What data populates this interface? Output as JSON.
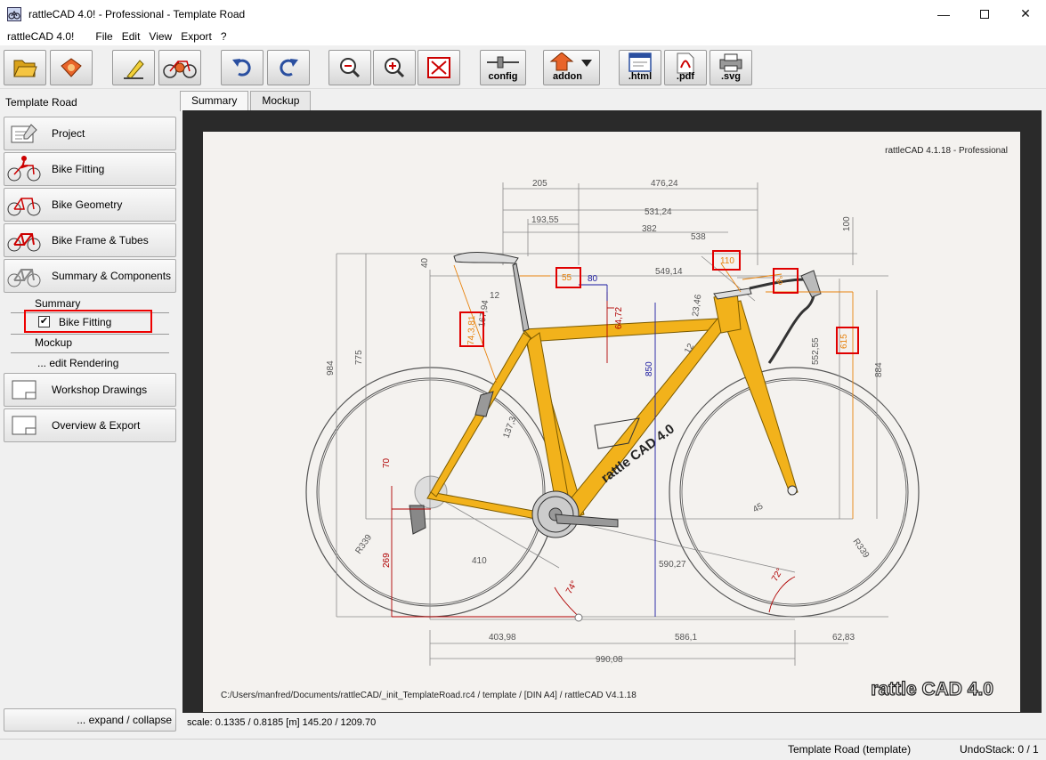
{
  "window": {
    "title": "rattleCAD 4.0! - Professional  - Template Road"
  },
  "menu": {
    "app_name": "rattleCAD 4.0!",
    "items": [
      "File",
      "Edit",
      "View",
      "Export",
      "?"
    ]
  },
  "toolbar": {
    "config_label": "config",
    "addon_label": "addon",
    "html_label": ".html",
    "pdf_label": ".pdf",
    "svg_label": ".svg"
  },
  "left_panel": {
    "title": "Template Road",
    "items": [
      "Project",
      "Bike Fitting",
      "Bike Geometry",
      "Bike Frame & Tubes",
      "Summary & Components"
    ],
    "summary_label": "Summary",
    "bike_fitting_check": "Bike Fitting",
    "bike_fitting_checked": true,
    "mockup_label": "Mockup",
    "edit_rendering_label": "... edit Rendering",
    "items2": [
      "Workshop Drawings",
      "Overview & Export"
    ],
    "expand_label": "... expand / collapse"
  },
  "tabs": [
    "Summary",
    "Mockup"
  ],
  "drawing": {
    "version_label": "rattleCAD  4.1.18  -  Professional",
    "footer_path": "C:/Users/manfred/Documents/rattleCAD/_init_TemplateRoad.rc4   /   template   /  [DIN A4]  /   rattleCAD   V4.1.18",
    "logo_text": "rattle CAD 4.0",
    "frame_text": "rattle CAD 4.0",
    "dims": {
      "d205": "205",
      "d476": "476,24",
      "d193": "193,55",
      "d531": "531,24",
      "d382": "382",
      "d538": "538",
      "d100": "100",
      "d40": "40",
      "d55": "55",
      "d80": "80",
      "d549": "549,14",
      "d110": "110",
      "d8": "8°",
      "d12a": "12",
      "d16794": "167,94",
      "d74381": "74,3,81",
      "d6472": "64,72",
      "d2346": "23,46",
      "d12b": "12",
      "d850": "850",
      "d615": "615",
      "d775": "775",
      "d984": "984",
      "d55255": "552,55",
      "d884": "884",
      "d1373": "137,3",
      "d70": "70",
      "d269": "269",
      "d410": "410",
      "d59027": "590,27",
      "d45": "45",
      "dR339a": "R339",
      "dR339b": "R339",
      "d74deg": "74°",
      "d72deg": "72°",
      "d40398": "403,98",
      "d5861": "586,1",
      "d6283": "62,83",
      "d99008": "990,08"
    }
  },
  "scale_text": "scale: 0.1335 / 0.8185  [m]  145.20 / 1209.70",
  "status": {
    "doc": "Template Road (template)",
    "undo": "UndoStack:  0 /  1"
  },
  "colors": {
    "frame": "#f2b21b",
    "frame_edge": "#7a5a00",
    "dim_grey": "#707070",
    "dim_orange": "#e8820c",
    "dim_red": "#b00000",
    "dim_blue": "#1a1aa0",
    "highlight": "#e00000"
  }
}
